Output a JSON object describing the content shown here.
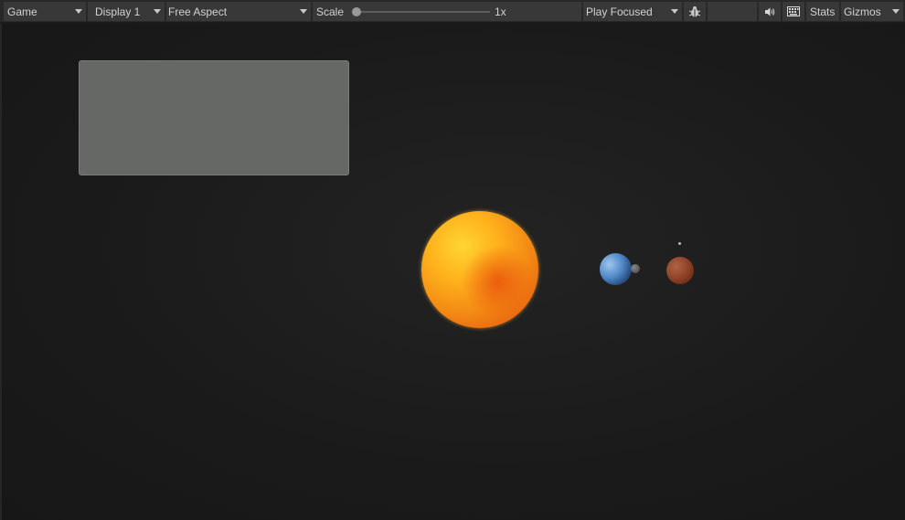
{
  "toolbar": {
    "game_tab": "Game",
    "display": "Display 1",
    "aspect": "Free Aspect",
    "scale_label": "Scale",
    "scale_value": "1x",
    "scale_slider_fraction": 0.0,
    "play_mode": "Play Focused",
    "stats": "Stats",
    "gizmos": "Gizmos",
    "icons": {
      "bug": "bug-icon",
      "audio": "speaker-icon",
      "keyboard": "keyboard-icon"
    }
  },
  "colors": {
    "toolbar_bg": "#282828",
    "button_bg": "#383838",
    "viewport_bg": "#1b1b1b",
    "panel": "#666866",
    "sun": "#ffb31c",
    "earth": "#4e86c4",
    "mars": "#8a3e24"
  }
}
